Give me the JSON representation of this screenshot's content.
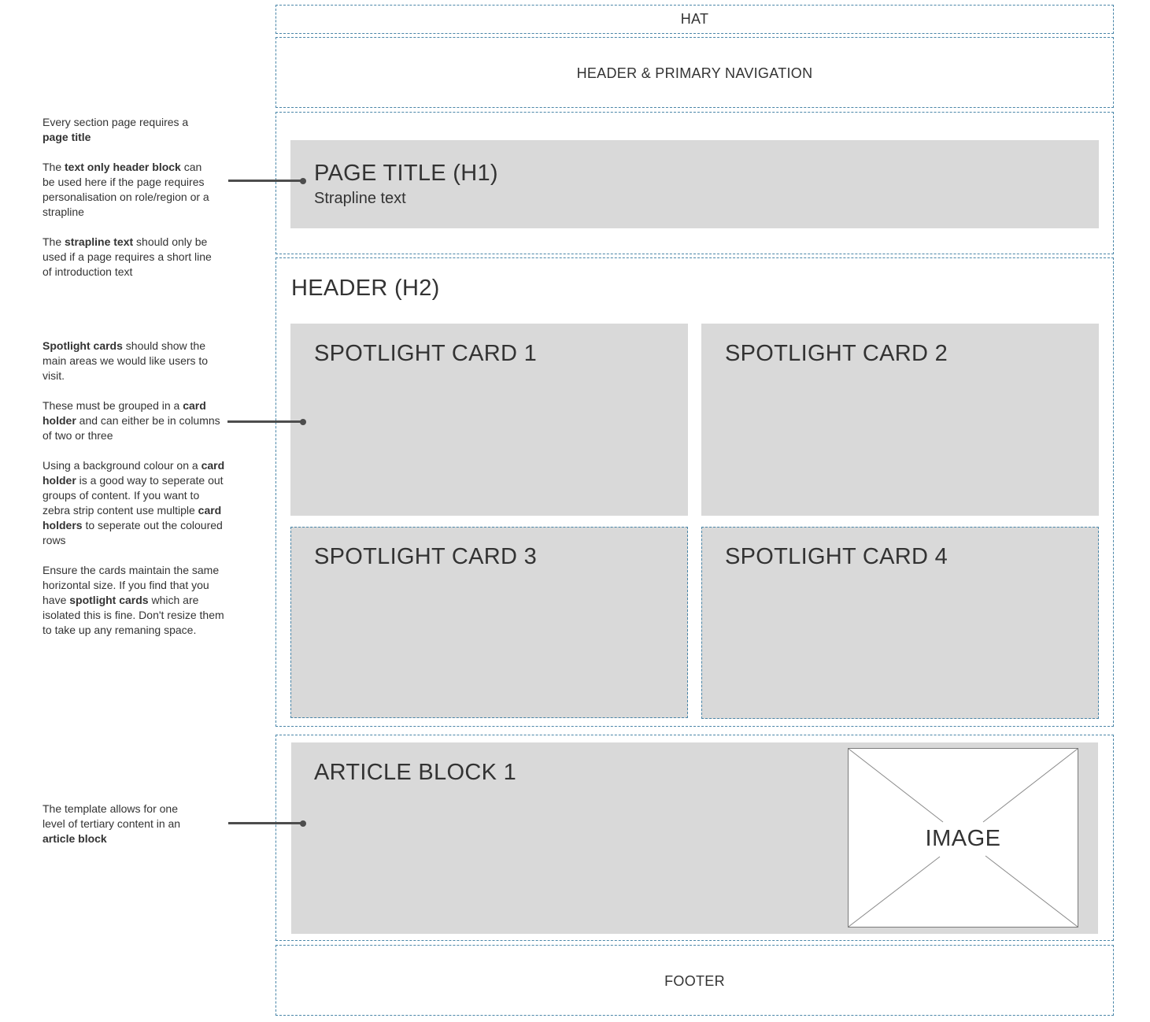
{
  "regions": {
    "hat": "HAT",
    "header_nav": "HEADER & PRIMARY NAVIGATION",
    "page_title": "PAGE TITLE (H1)",
    "strapline": "Strapline text",
    "section_header": "HEADER (H2)",
    "cards": [
      "SPOTLIGHT CARD 1",
      "SPOTLIGHT CARD 2",
      "SPOTLIGHT CARD 3",
      "SPOTLIGHT CARD 4"
    ],
    "article_block": "ARTICLE BLOCK 1",
    "image_placeholder": "IMAGE",
    "footer": "FOOTER"
  },
  "notes": {
    "page_title": [
      [
        {
          "t": "Every section page requires a "
        },
        {
          "t": "page title",
          "b": true
        }
      ],
      [
        {
          "t": "The "
        },
        {
          "t": "text only header block",
          "b": true
        },
        {
          "t": " can be used here if the page requires personalisation on role/region or a strapline"
        }
      ],
      [
        {
          "t": "The "
        },
        {
          "t": "strapline text",
          "b": true
        },
        {
          "t": " should only be used if a page requires a short line of introduction text"
        }
      ]
    ],
    "spotlight": [
      [
        {
          "t": "Spotlight cards",
          "b": true
        },
        {
          "t": " should show the main areas we would like users to visit."
        }
      ],
      [
        {
          "t": "These must be grouped in a "
        },
        {
          "t": "card holder",
          "b": true
        },
        {
          "t": " and can either be in columns of two or three"
        }
      ],
      [
        {
          "t": "Using a background colour on a "
        },
        {
          "t": "card holder",
          "b": true
        },
        {
          "t": " is a good way to seperate out groups of content. If you want to zebra strip content use multiple "
        },
        {
          "t": "card holders",
          "b": true
        },
        {
          "t": " to seperate out the coloured rows"
        }
      ],
      [
        {
          "t": "Ensure the cards maintain the same horizontal size. If you find that you have "
        },
        {
          "t": "spotlight cards",
          "b": true
        },
        {
          "t": " which are isolated this is fine. Don't resize them to take up any remaning space."
        }
      ]
    ],
    "article": [
      [
        {
          "t": "The template allows for one level of tertiary content in an "
        },
        {
          "t": "article block",
          "b": true
        }
      ]
    ]
  },
  "colors": {
    "guide_dash": "#4a86a8",
    "block_fill": "#d9d9d9",
    "connector": "#4d4d4d",
    "text": "#333333"
  }
}
